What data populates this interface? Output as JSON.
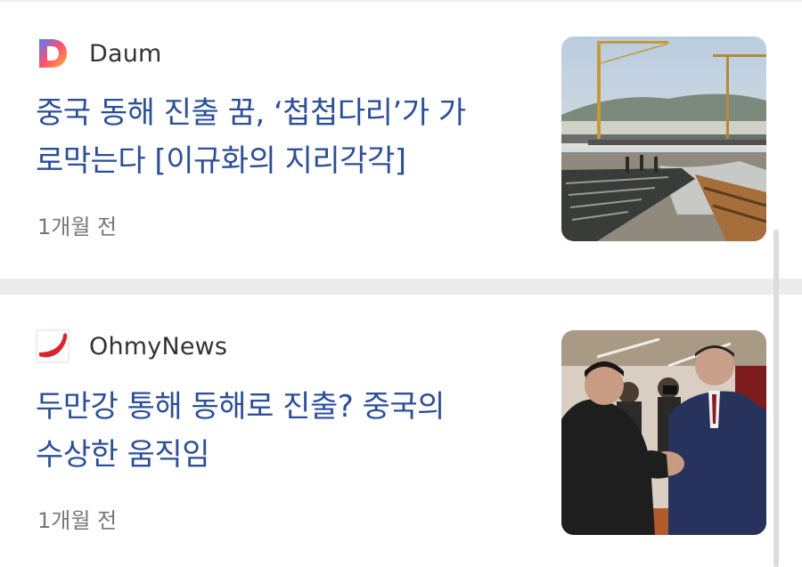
{
  "articles": [
    {
      "source": "Daum",
      "logo_icon": "daum-logo-icon",
      "headline_line1": "중국 동해 진출 꿈, ‘첩첩다리’가 가",
      "headline_line2": "로막는다 [이규화의 지리각각]",
      "time": "1개월 전",
      "thumbnail": "bridge-construction-photo"
    },
    {
      "source": "OhmyNews",
      "logo_icon": "ohmynews-logo-icon",
      "headline_line1": "두만강 통해 동해로 진출? 중국의",
      "headline_line2": "수상한 움직임",
      "time": "1개월 전",
      "thumbnail": "leaders-handshake-photo"
    }
  ],
  "colors": {
    "headline": "#2c4f97",
    "source": "#333333",
    "time": "#777777",
    "separator": "#ebebee"
  }
}
